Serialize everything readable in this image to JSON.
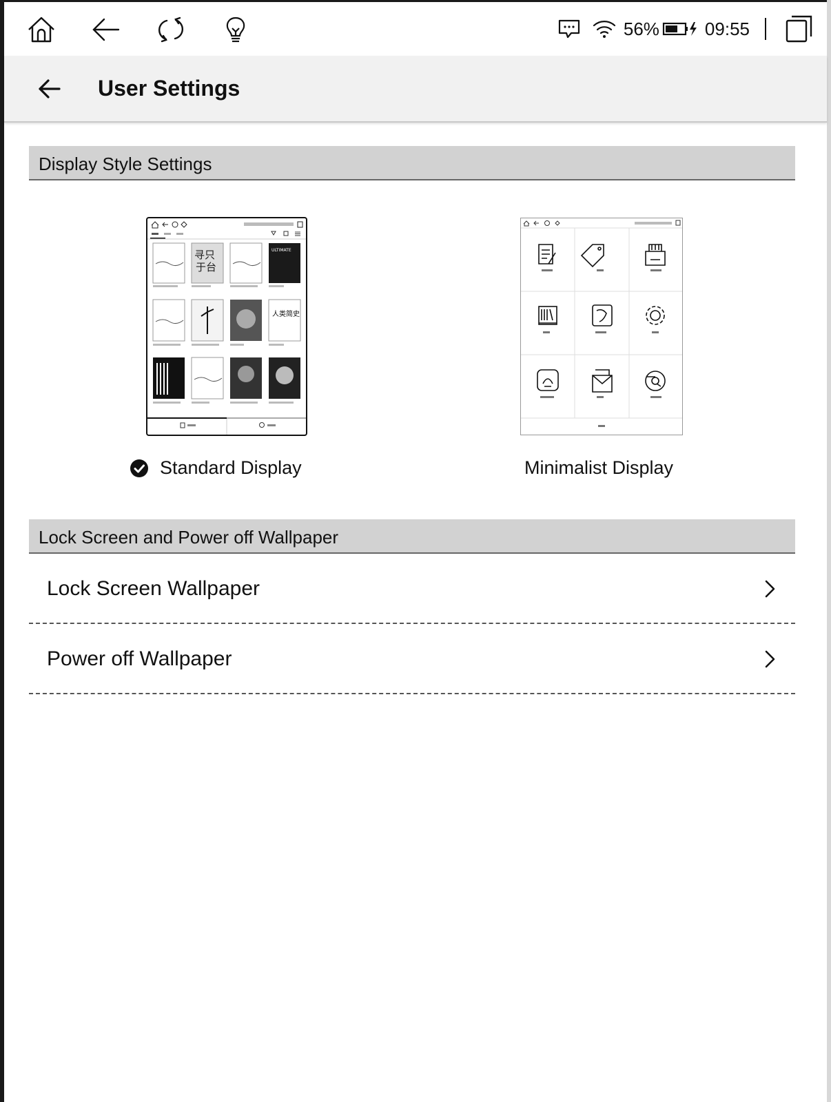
{
  "status_bar": {
    "battery_percent": "56%",
    "time": "09:55",
    "icons": [
      "home-icon",
      "back-arrow-icon",
      "refresh-icon",
      "lightbulb-icon",
      "chat-icon",
      "wifi-icon",
      "battery-charging-icon",
      "window-switch-icon"
    ]
  },
  "header": {
    "title": "User Settings"
  },
  "display_style": {
    "section_title": "Display Style Settings",
    "options": [
      {
        "label": "Standard Display",
        "selected": true
      },
      {
        "label": "Minimalist Display",
        "selected": false
      }
    ]
  },
  "wallpaper": {
    "section_title": "Lock Screen and Power off Wallpaper",
    "rows": [
      {
        "label": "Lock Screen Wallpaper"
      },
      {
        "label": "Power off Wallpaper"
      }
    ]
  }
}
